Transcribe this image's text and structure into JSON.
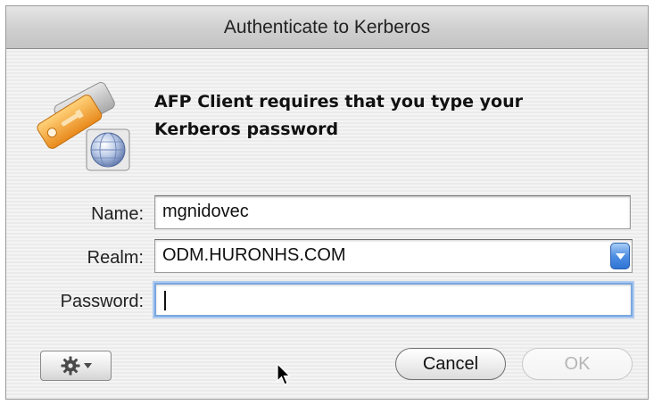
{
  "window": {
    "title": "Authenticate to Kerberos"
  },
  "message": {
    "line1": "AFP Client requires that you type your",
    "line2": "Kerberos password"
  },
  "form": {
    "name_label": "Name:",
    "name_value": "mgnidovec",
    "realm_label": "Realm:",
    "realm_value": "ODM.HURONHS.COM",
    "password_label": "Password:",
    "password_value": ""
  },
  "buttons": {
    "cancel_label": "Cancel",
    "ok_label": "OK",
    "action_menu_icon": "gear-icon"
  },
  "icons": {
    "app_icon": "kerberos-keys-globe-icon",
    "select_arrow": "chevron-down-icon",
    "pointer": "mouse-pointer-icon"
  },
  "colors": {
    "focus_ring": "#7aa7e0",
    "select_arrow": "#4f8fe3",
    "key_orange": "#f3a23a"
  }
}
